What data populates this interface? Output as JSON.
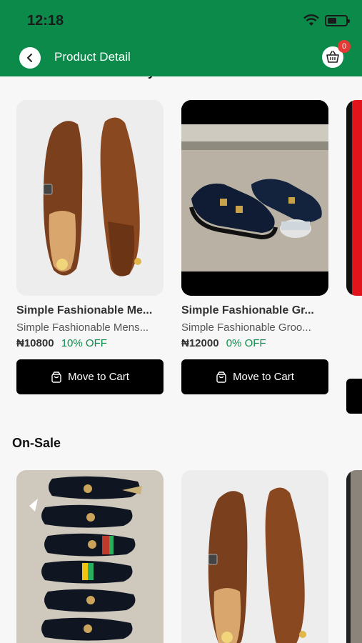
{
  "status_bar": {
    "time": "12:18",
    "battery_level": 0.5
  },
  "nav": {
    "title": "Product Detail",
    "cart_count": "0"
  },
  "vendor_section": {
    "title": "Other Products sold by Vendor",
    "products": [
      {
        "name": "Simple Fashionable Me...",
        "description": "Simple Fashionable Mens...",
        "price": "₦10800",
        "discount": "10% OFF",
        "button_label": "Move to Cart"
      },
      {
        "name": "Simple Fashionable Gr...",
        "description": "Simple Fashionable Groo...",
        "price": "₦12000",
        "discount": "0% OFF",
        "button_label": "Move to Cart"
      }
    ]
  },
  "on_sale_section": {
    "title": "On-Sale"
  }
}
